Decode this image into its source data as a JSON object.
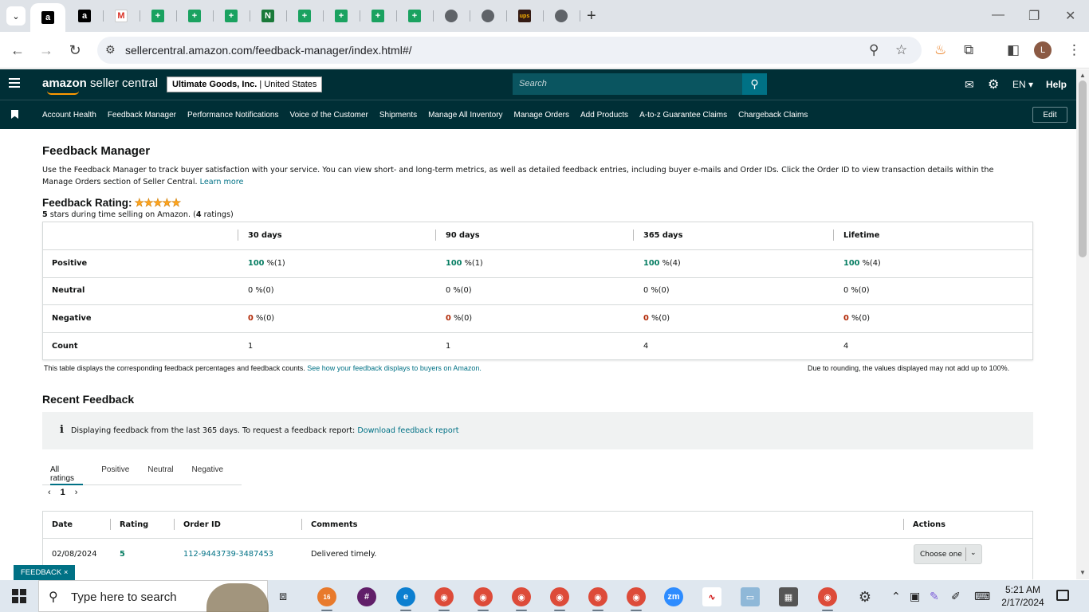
{
  "browser": {
    "url": "sellercentral.amazon.com/feedback-manager/index.html#/",
    "profile_initial": "L",
    "tabs": [
      {
        "icon": "amazon-icon",
        "active": true
      },
      {
        "icon": "amazon-icon"
      },
      {
        "icon": "gmail-icon"
      },
      {
        "icon": "sheets-icon"
      },
      {
        "icon": "sheets-icon"
      },
      {
        "icon": "sheets-icon"
      },
      {
        "icon": "n-app-icon"
      },
      {
        "icon": "sheets-icon"
      },
      {
        "icon": "sheets-icon"
      },
      {
        "icon": "sheets-icon"
      },
      {
        "icon": "sheets-icon"
      },
      {
        "icon": "globe-icon"
      },
      {
        "icon": "globe-icon"
      },
      {
        "icon": "ups-icon"
      },
      {
        "icon": "globe-icon"
      }
    ]
  },
  "header": {
    "logo_bold": "amazon",
    "logo_rest": " seller central",
    "account_name": "Ultimate Goods, Inc.",
    "account_region": "United States",
    "search_placeholder": "Search",
    "language": "EN",
    "help": "Help"
  },
  "nav": {
    "links": [
      "Account Health",
      "Feedback Manager",
      "Performance Notifications",
      "Voice of the Customer",
      "Shipments",
      "Manage All Inventory",
      "Manage Orders",
      "Add Products",
      "A-to-z Guarantee Claims",
      "Chargeback Claims"
    ],
    "edit": "Edit"
  },
  "page": {
    "title": "Feedback Manager",
    "intro": "Use the Feedback Manager to track buyer satisfaction with your service. You can view short- and long-term metrics, as well as detailed feedback entries, including buyer e-mails and Order IDs. Click the Order ID to view transaction details within the Manage Orders section of Seller Central.",
    "learn_more": "Learn more",
    "rating_label": "Feedback Rating:",
    "rating_stars": 5,
    "rating_stars_glyph": "★★★★★",
    "rating_sub_stars": "5",
    "rating_sub_text": " stars during time selling on Amazon. (",
    "rating_sub_count": "4",
    "rating_sub_end": " ratings)"
  },
  "rating_table": {
    "columns": [
      "30 days",
      "90 days",
      "365 days",
      "Lifetime"
    ],
    "rows": [
      {
        "label": "Positive",
        "cells": [
          {
            "num": "100",
            "rest": " %(1)"
          },
          {
            "num": "100",
            "rest": " %(1)"
          },
          {
            "num": "100",
            "rest": " %(4)"
          },
          {
            "num": "100",
            "rest": " %(4)"
          }
        ]
      },
      {
        "label": "Neutral",
        "cells": [
          {
            "num": "0",
            "rest": " %(0)"
          },
          {
            "num": "0",
            "rest": " %(0)"
          },
          {
            "num": "0",
            "rest": " %(0)"
          },
          {
            "num": "0",
            "rest": " %(0)"
          }
        ]
      },
      {
        "label": "Negative",
        "cells": [
          {
            "num": "0",
            "rest": " %(0)"
          },
          {
            "num": "0",
            "rest": " %(0)"
          },
          {
            "num": "0",
            "rest": " %(0)"
          },
          {
            "num": "0",
            "rest": " %(0)"
          }
        ]
      },
      {
        "label": "Count",
        "cells": [
          {
            "num": "1",
            "rest": ""
          },
          {
            "num": "1",
            "rest": ""
          },
          {
            "num": "4",
            "rest": ""
          },
          {
            "num": "4",
            "rest": ""
          }
        ]
      }
    ],
    "note_left": "This table displays the corresponding feedback percentages and feedback counts.",
    "note_link": "See how your feedback displays to buyers on Amazon.",
    "note_right": "Due to rounding, the values displayed may not add up to 100%."
  },
  "recent": {
    "title": "Recent Feedback",
    "info_text": "Displaying feedback from the last 365 days. To request a feedback report:",
    "info_link": "Download feedback report",
    "tabs": [
      "All ratings",
      "Positive",
      "Neutral",
      "Negative"
    ],
    "page": "1",
    "columns": [
      "Date",
      "Rating",
      "Order ID",
      "Comments",
      "Actions"
    ],
    "rows": [
      {
        "date": "02/08/2024",
        "rating": "5",
        "order_id": "112-9443739-3487453",
        "comment": "Delivered timely.",
        "action": "Choose one"
      }
    ]
  },
  "feedback_pill": "FEEDBACK ×",
  "taskbar": {
    "search_placeholder": "Type here to search",
    "time": "5:21 AM",
    "date": "2/17/2024",
    "badge": "16"
  },
  "colors": {
    "header_bg": "#002f36",
    "link": "#007185",
    "positive": "#067d62",
    "negative": "#b12704",
    "star": "#ffa41c"
  }
}
